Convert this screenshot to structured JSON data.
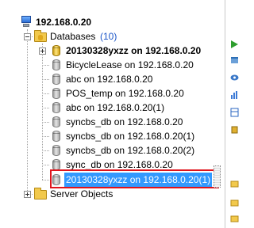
{
  "tree": {
    "server": {
      "label": "192.168.0.20",
      "icon": "server-icon"
    },
    "databases": {
      "label": "Databases",
      "count": "(10)",
      "icon": "folder-database-icon"
    },
    "items": [
      {
        "label": "20130328yxzz on 192.168.0.20",
        "icon": "database-icon",
        "bold": true,
        "expandable": true
      },
      {
        "label": "BicycleLease on 192.168.0.20",
        "icon": "database-icon"
      },
      {
        "label": "abc on 192.168.0.20",
        "icon": "database-icon"
      },
      {
        "label": "POS_temp on 192.168.0.20",
        "icon": "database-icon"
      },
      {
        "label": "abc on 192.168.0.20(1)",
        "icon": "database-icon"
      },
      {
        "label": "syncbs_db on 192.168.0.20",
        "icon": "database-icon"
      },
      {
        "label": "syncbs_db on 192.168.0.20(1)",
        "icon": "database-icon"
      },
      {
        "label": "syncbs_db on 192.168.0.20(2)",
        "icon": "database-icon"
      },
      {
        "label": "sync_db on 192.168.0.20",
        "icon": "database-icon"
      },
      {
        "label": "20130328yxzz on 192.168.0.20(1)",
        "icon": "database-icon",
        "selected": true
      }
    ],
    "server_objects": {
      "label": "Server Objects",
      "icon": "folder-icon"
    }
  },
  "colors": {
    "selection": "#3399ff",
    "highlight_border": "#e0141c",
    "db_gold": "#f2c94c"
  }
}
